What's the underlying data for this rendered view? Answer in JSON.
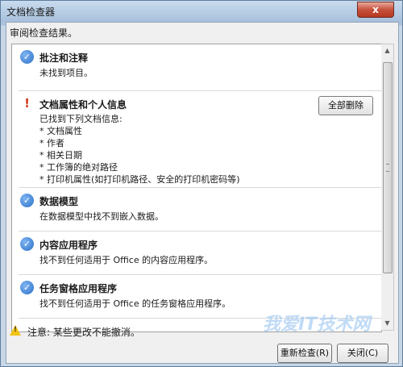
{
  "window": {
    "title": "文档检查器",
    "close_label": "x"
  },
  "heading": "审阅检查结果。",
  "results": [
    {
      "status": "ok",
      "title": "批注和注释",
      "desc": "未找到项目。"
    },
    {
      "status": "found",
      "title": "文档属性和个人信息",
      "desc": "已找到下列文档信息:",
      "details": [
        "* 文档属性",
        "* 作者",
        "* 相关日期",
        "* 工作簿的绝对路径",
        "* 打印机属性(如打印机路径、安全的打印机密码等)"
      ],
      "button_label": "全部删除"
    },
    {
      "status": "ok",
      "title": "数据模型",
      "desc": "在数据模型中找不到嵌入数据。"
    },
    {
      "status": "ok",
      "title": "内容应用程序",
      "desc": "找不到任何适用于 Office 的内容应用程序。"
    },
    {
      "status": "ok",
      "title": "任务窗格应用程序",
      "desc": "找不到任何适用于 Office 的任务窗格应用程序。"
    }
  ],
  "footer": {
    "warning": "注意: 某些更改不能撤消。",
    "reinspect_label": "重新检查(R)",
    "close_label": "关闭(C)"
  },
  "watermark": "我爱IT技术网"
}
